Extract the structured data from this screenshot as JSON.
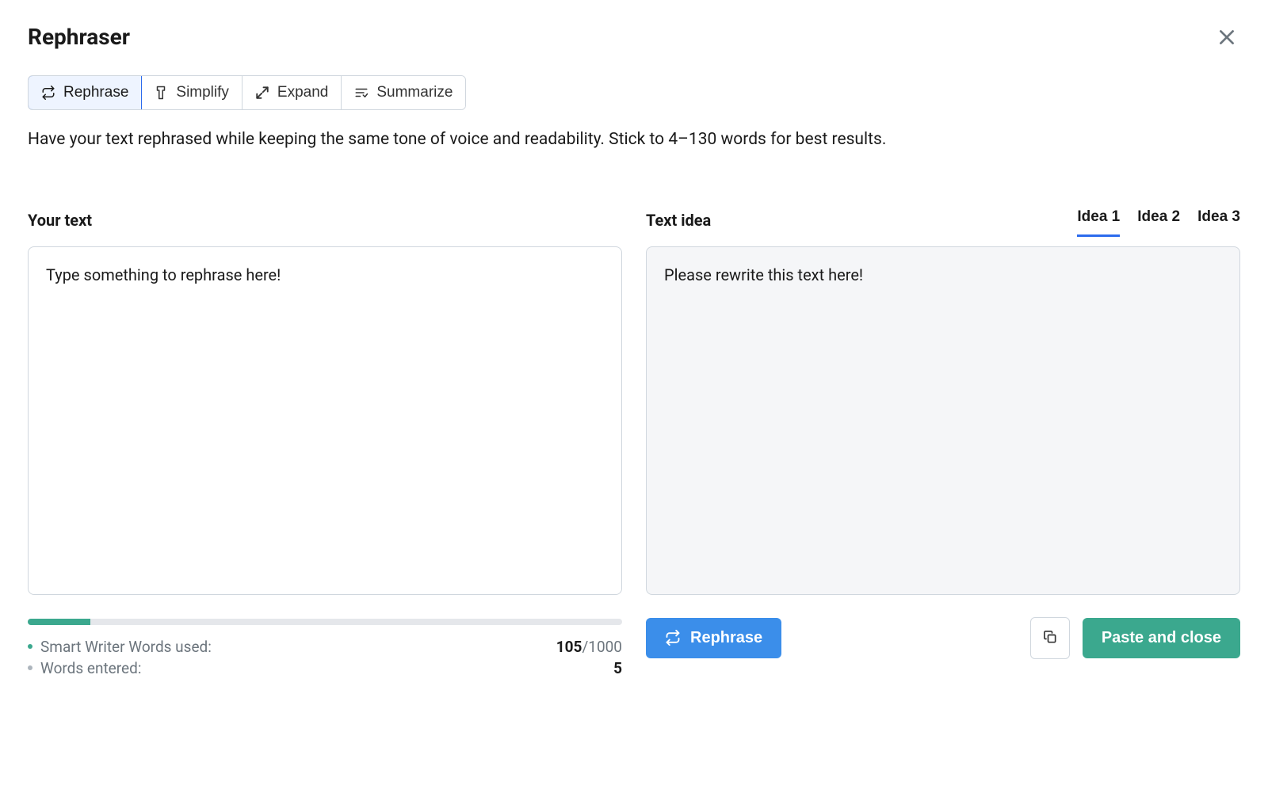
{
  "title": "Rephraser",
  "tabs": {
    "rephrase": "Rephrase",
    "simplify": "Simplify",
    "expand": "Expand",
    "summarize": "Summarize"
  },
  "description": "Have your text rephrased while keeping the same tone of voice and readability. Stick to 4–130 words for best results.",
  "left": {
    "title": "Your text",
    "placeholder": "Type something to rephrase here!",
    "value": "Type something to rephrase here!"
  },
  "right": {
    "title": "Text idea",
    "idea_tabs": [
      "Idea 1",
      "Idea 2",
      "Idea 3"
    ],
    "output": "Please rewrite this text here!"
  },
  "stats": {
    "words_used_label": "Smart Writer Words used:",
    "words_used_value": "105",
    "words_used_total": "/1000",
    "words_entered_label": "Words entered:",
    "words_entered_value": "5"
  },
  "actions": {
    "rephrase": "Rephrase",
    "paste_close": "Paste and close"
  }
}
